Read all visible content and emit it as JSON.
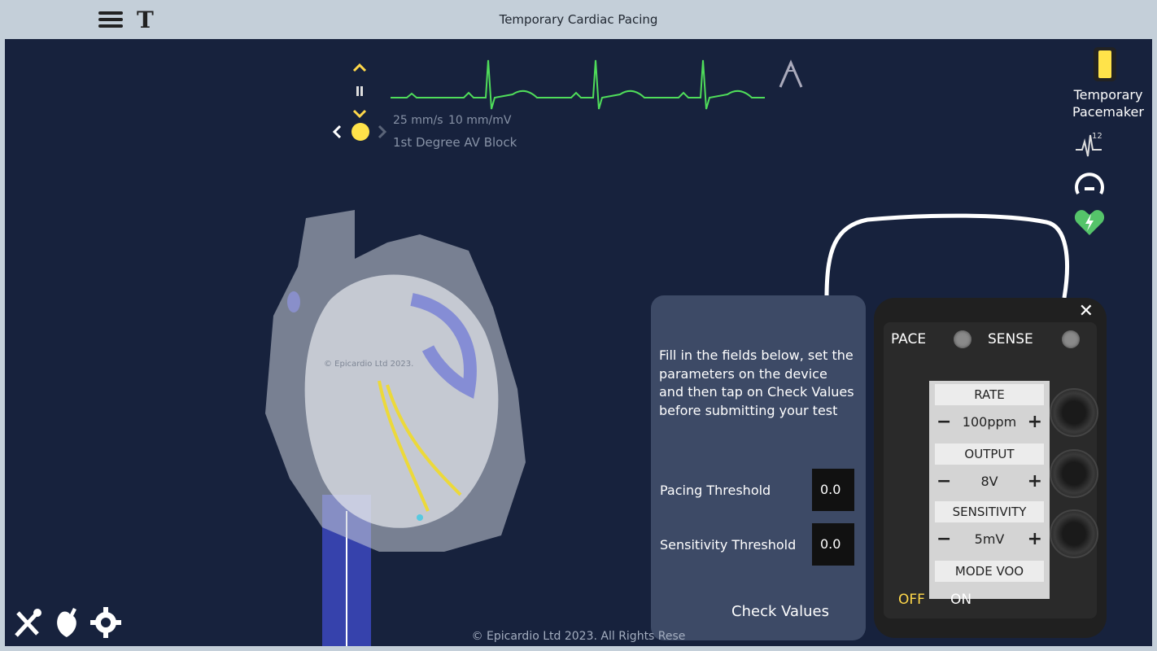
{
  "header": {
    "title": "Temporary Cardiac Pacing",
    "text_tool_label": "T"
  },
  "ecg": {
    "speed": "25 mm/s",
    "gain": "10 mm/mV",
    "rhythm": "1st Degree AV Block",
    "trace_color": "#4fdd5a"
  },
  "right_panel": {
    "pacemaker_label_1": "Temporary",
    "pacemaker_label_2": "Pacemaker",
    "lead_badge": "12"
  },
  "heart": {
    "watermark": "© Epicardio Ltd 2023."
  },
  "pacing_panel": {
    "instructions": "Fill in the fields below, set the parameters on the device and then tap on Check Values before submitting your test",
    "pacing_threshold_label": "Pacing Threshold",
    "pacing_threshold_value": "0.0",
    "sensitivity_threshold_label": "Sensitivity Threshold",
    "sensitivity_threshold_value": "0.0",
    "check_button": "Check Values"
  },
  "device": {
    "pace_label": "PACE",
    "sense_label": "SENSE",
    "rate_label": "RATE",
    "rate_value": "100ppm",
    "output_label": "OUTPUT",
    "output_value": "8V",
    "sensitivity_label": "SENSITIVITY",
    "sensitivity_value": "5mV",
    "mode_label": "MODE VOO",
    "off_label": "OFF",
    "on_label": "ON",
    "close_label": "✕",
    "off_color": "#ffd84a"
  },
  "footer": {
    "copyright": "© Epicardio Ltd 2023. All Rights Rese"
  },
  "colors": {
    "stage": "#17223d",
    "accent": "#ffd84a",
    "panel": "#3d4a66",
    "topbar": "#c4cfd9"
  }
}
